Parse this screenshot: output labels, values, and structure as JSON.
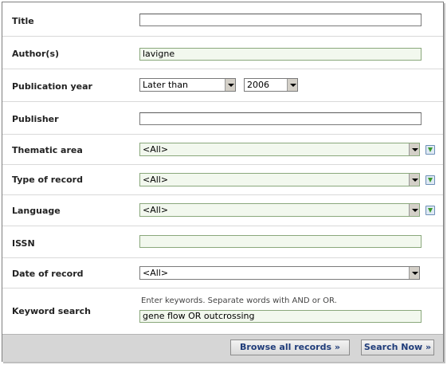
{
  "form": {
    "title": {
      "label": "Title",
      "value": ""
    },
    "authors": {
      "label": "Author(s)",
      "value": "lavigne"
    },
    "publication_year": {
      "label": "Publication year",
      "operator": "Later than",
      "year": "2006"
    },
    "publisher": {
      "label": "Publisher",
      "value": ""
    },
    "thematic_area": {
      "label": "Thematic area",
      "value": "<All>"
    },
    "type_of_record": {
      "label": "Type of record",
      "value": "<All>"
    },
    "language": {
      "label": "Language",
      "value": "<All>"
    },
    "issn": {
      "label": "ISSN",
      "value": ""
    },
    "date_of_record": {
      "label": "Date of record",
      "value": "<All>"
    },
    "keyword_search": {
      "label": "Keyword search",
      "hint": "Enter keywords. Separate words with AND or OR.",
      "value": "gene flow OR outcrossing"
    }
  },
  "footer": {
    "browse_label": "Browse all records »",
    "search_label": "Search Now »"
  },
  "colors": {
    "field_highlight": "#f2f8ee",
    "footer_bg": "#d6d6d6",
    "button_text": "#1f3c7a"
  }
}
